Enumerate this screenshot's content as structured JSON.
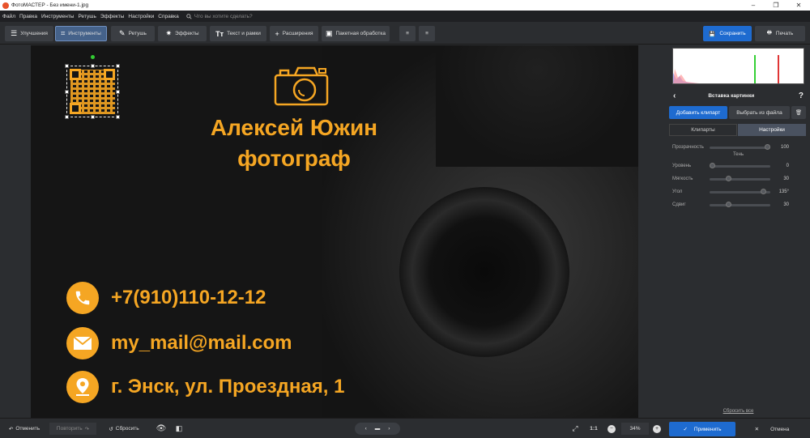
{
  "window": {
    "title": "ФотоМАСТЕР - Без имени-1.jpg"
  },
  "menu": {
    "items": [
      "Файл",
      "Правка",
      "Инструменты",
      "Ретушь",
      "Эффекты",
      "Настройки",
      "Справка"
    ],
    "search_placeholder": "Что вы хотите сделать?"
  },
  "toolbar": {
    "tabs": [
      "Улучшения",
      "Инструменты",
      "Ретушь",
      "Эффекты",
      "Текст и рамки",
      "Расширения",
      "Пакетная обработка"
    ],
    "active_tab": "Инструменты",
    "save_label": "Сохранить",
    "print_label": "Печать"
  },
  "card": {
    "name": "Алексей Южин",
    "profession": "фотограф",
    "phone": "+7(910)110-12-12",
    "email": "my_mail@mail.com",
    "address": "г. Энск, ул. Проездная, 1",
    "accent_color": "#f5a623"
  },
  "panel": {
    "title": "Вставка картинки",
    "help_label": "?",
    "add_clipart_label": "Добавить клипарт",
    "from_file_label": "Выбрать из файла",
    "tab_cliparts": "Клипарты",
    "tab_settings": "Настройки",
    "active_tab": "Настройки",
    "shadow_title": "Тень",
    "sliders": [
      {
        "label": "Прозрачность",
        "value": "100",
        "fraction": 1.0
      },
      {
        "label": "Уровень",
        "value": "0",
        "fraction": 0.0
      },
      {
        "label": "Мягкость",
        "value": "30",
        "fraction": 0.3
      },
      {
        "label": "Угол",
        "value": "135°",
        "fraction": 0.93
      },
      {
        "label": "Сдвиг",
        "value": "30",
        "fraction": 0.3
      }
    ],
    "reset_all_label": "Сбросить все",
    "apply_label": "Применить",
    "cancel_label": "Отмена"
  },
  "bottom": {
    "undo_label": "Отменить",
    "redo_label": "Повторить",
    "reset_label": "Сбросить",
    "zoom_ratio": "1:1",
    "zoom_level": "34%"
  }
}
